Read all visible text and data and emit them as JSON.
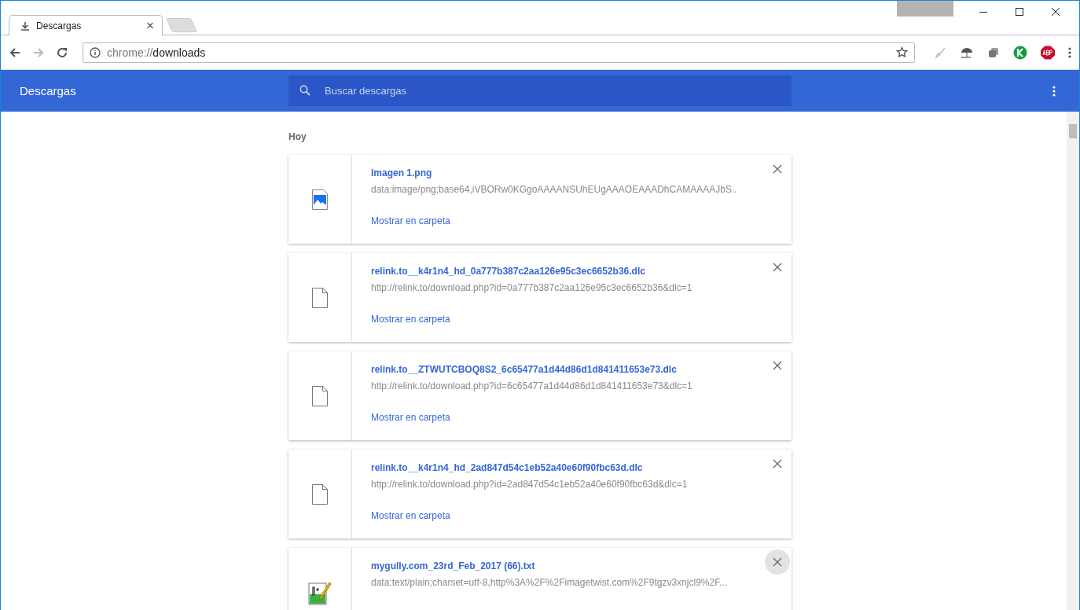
{
  "tab": {
    "title": "Descargas",
    "close": "×"
  },
  "address": {
    "scheme": "chrome://",
    "path": "downloads"
  },
  "header": {
    "title": "Descargas",
    "search_placeholder": "Buscar descargas"
  },
  "section": "Hoy",
  "downloads": [
    {
      "kind": "image",
      "name": "Imagen 1.png",
      "url": "data:image/png;base64,iVBORw0KGgoAAAANSUhEUgAAAOEAAADhCAMAAAAJbS..",
      "action": "Mostrar en carpeta",
      "close_hovered": false
    },
    {
      "kind": "file",
      "name": "relink.to__k4r1n4_hd_0a777b387c2aa126e95c3ec6652b36.dlc",
      "url": "http://relink.to/download.php?id=0a777b387c2aa126e95c3ec6652b36&dlc=1",
      "action": "Mostrar en carpeta",
      "close_hovered": false
    },
    {
      "kind": "file",
      "name": "relink.to__ZTWUTCBOQ8S2_6c65477a1d44d86d1d841411653e73.dlc",
      "url": "http://relink.to/download.php?id=6c65477a1d44d86d1d841411653e73&dlc=1",
      "action": "Mostrar en carpeta",
      "close_hovered": false
    },
    {
      "kind": "file",
      "name": "relink.to__k4r1n4_hd_2ad847d54c1eb52a40e60f90fbc63d.dlc",
      "url": "http://relink.to/download.php?id=2ad847d54c1eb52a40e60f90fbc63d&dlc=1",
      "action": "Mostrar en carpeta",
      "close_hovered": false
    },
    {
      "kind": "notepad",
      "name": "mygully.com_23rd_Feb_2017 (66).txt",
      "url": "data:text/plain;charset=utf-8,http%3A%2F%2Fimagetwist.com%2F9tgzv3xnjcl9%2F...",
      "close_hovered": true
    }
  ]
}
